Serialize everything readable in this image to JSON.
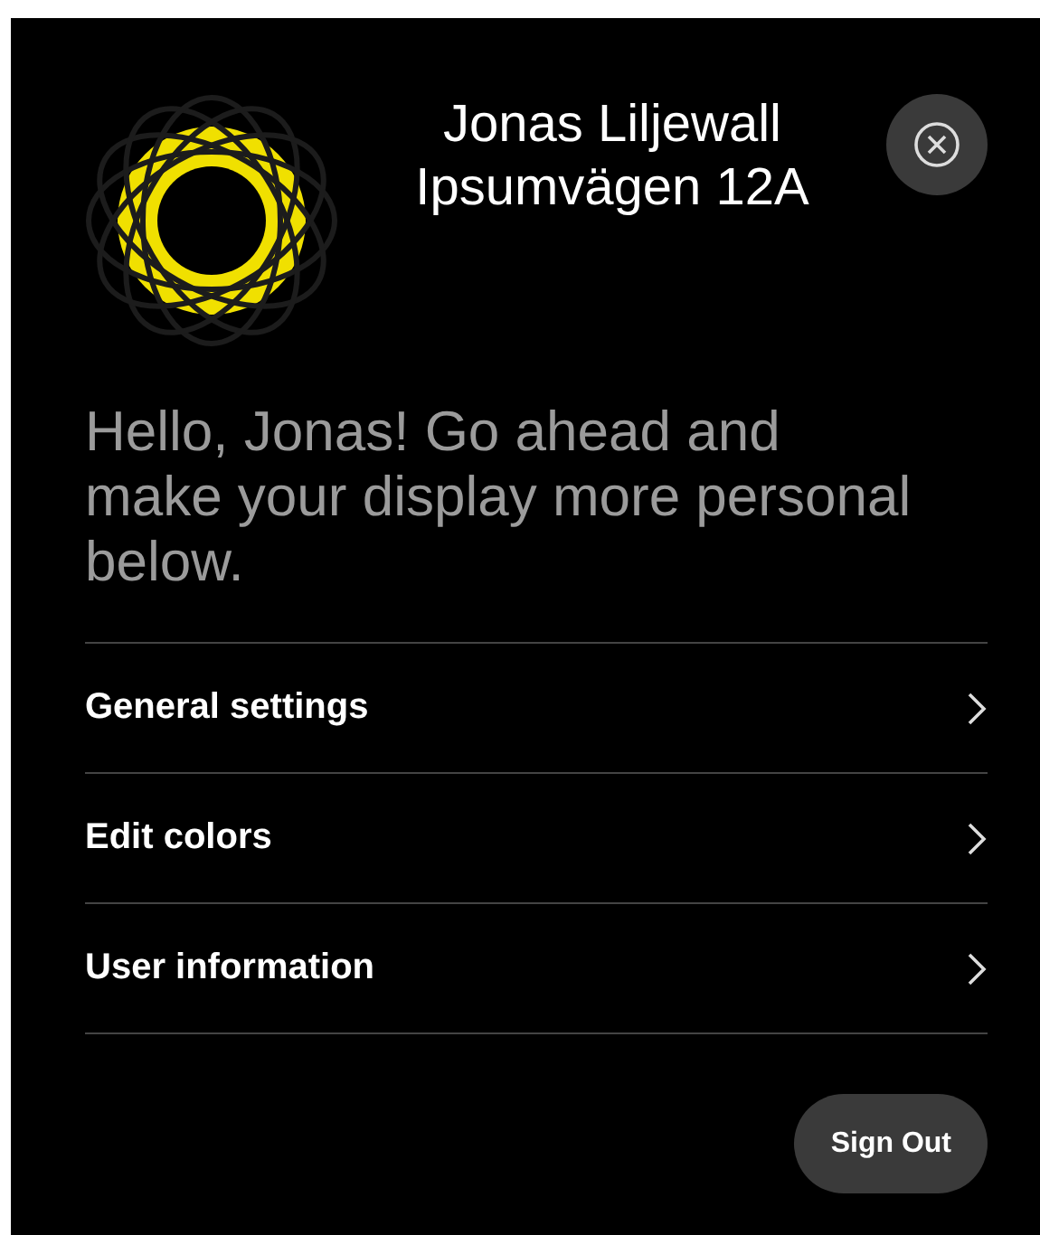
{
  "profile": {
    "name": "Jonas Liljewall",
    "address": "Ipsumvägen 12A"
  },
  "greeting": "Hello, Jonas! Go ahead and make your display more personal below.",
  "menu": [
    {
      "label": "General settings"
    },
    {
      "label": "Edit colors"
    },
    {
      "label": "User information"
    }
  ],
  "sign_out": "Sign Out"
}
